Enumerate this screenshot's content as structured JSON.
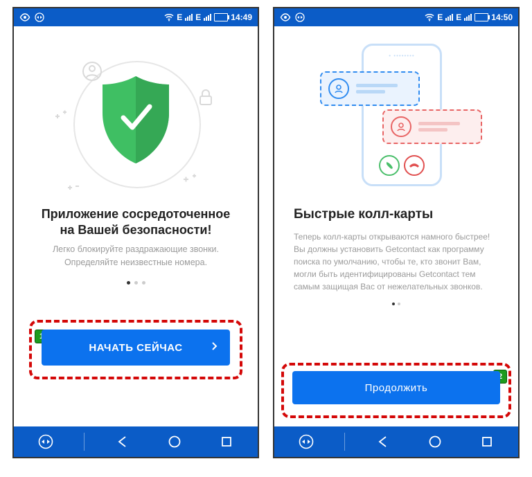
{
  "screens": {
    "left": {
      "status": {
        "time": "14:49",
        "net": "E"
      },
      "title": "Приложение сосредоточенное на Вашей безопасности!",
      "subtitle": "Легко блокируйте раздражающие звонки. Определяйте неизвестные номера.",
      "button_label": "НАЧАТЬ СЕЙЧАС",
      "badge": "1",
      "active_dot": 0,
      "dot_count": 3
    },
    "right": {
      "status": {
        "time": "14:50",
        "net": "E"
      },
      "title": "Быстрые колл-карты",
      "subtitle": "Теперь колл-карты открываются намного быстрее! Вы должны установить Getcontact как программу поиска по умолчанию, чтобы те, кто звонит Вам, могли быть идентифицированы Getcontact тем самым защищая Вас от нежелательных звонков.",
      "button_label": "Продолжить",
      "badge": "2",
      "active_dot": 0,
      "dot_count": 2
    }
  }
}
